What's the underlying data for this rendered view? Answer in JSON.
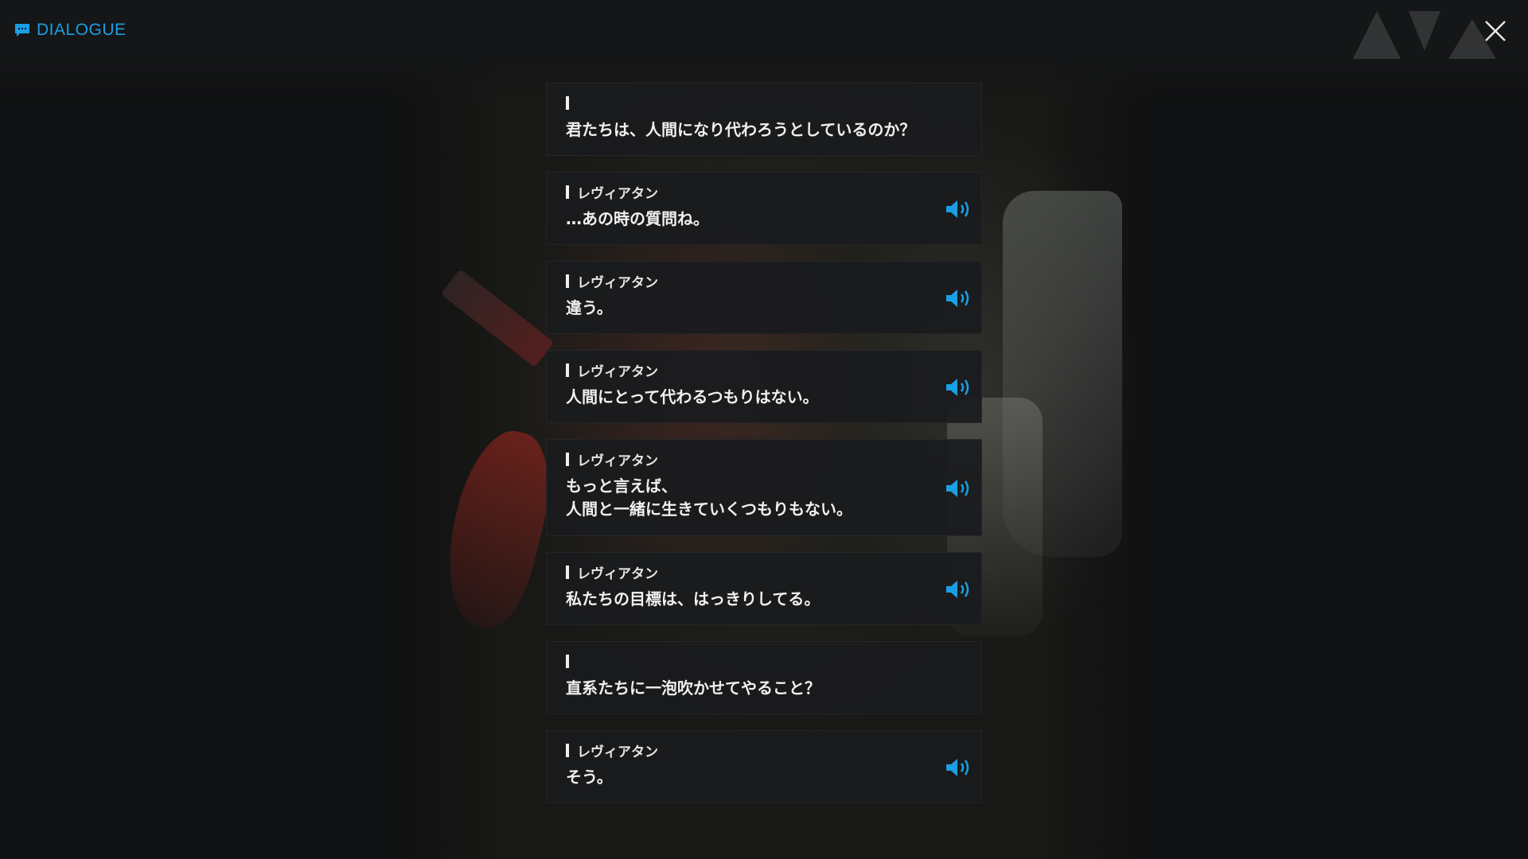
{
  "header": {
    "title": "DIALOGUE",
    "title_icon": "chat-bubble-icon",
    "close_icon": "close-icon"
  },
  "colors": {
    "accent": "#1a9fe4",
    "panel": "#1a1b1d",
    "text": "#f0f0f0",
    "background": "#101112"
  },
  "entries": [
    {
      "speaker": "",
      "line": "君たちは、人間になり代わろうとしているのか？",
      "has_voice": false
    },
    {
      "speaker": "レヴィアタン",
      "line": "…あの時の質問ね。",
      "has_voice": true
    },
    {
      "speaker": "レヴィアタン",
      "line": "違う。",
      "has_voice": true
    },
    {
      "speaker": "レヴィアタン",
      "line": "人間にとって代わるつもりはない。",
      "has_voice": true
    },
    {
      "speaker": "レヴィアタン",
      "line": "もっと言えば、\n人間と一緒に生きていくつもりもない。",
      "has_voice": true
    },
    {
      "speaker": "レヴィアタン",
      "line": "私たちの目標は、はっきりしてる。",
      "has_voice": true
    },
    {
      "speaker": "",
      "line": "直系たちに一泡吹かせてやること？",
      "has_voice": false
    },
    {
      "speaker": "レヴィアタン",
      "line": "そう。",
      "has_voice": true
    }
  ]
}
